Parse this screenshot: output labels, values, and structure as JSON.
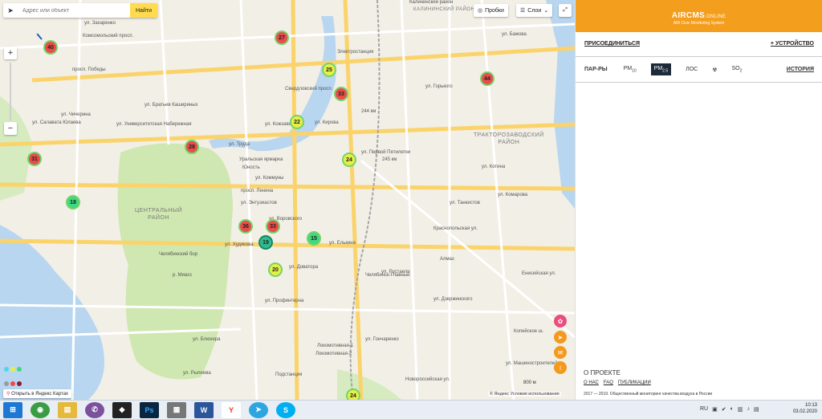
{
  "search": {
    "placeholder": "Адрес или объект",
    "button": "Найти"
  },
  "controls": {
    "traffic": "Пробки",
    "layers": "Слои"
  },
  "zoom": {
    "plus": "+",
    "minus": "−"
  },
  "map_labels": [
    {
      "text": "ул. Захаренко"
    },
    {
      "text": "Комсомольский просп."
    },
    {
      "text": "просп. Победы"
    },
    {
      "text": "ул. Братьев Кашириных"
    },
    {
      "text": "ул. Университетская Набережная"
    },
    {
      "text": "ул. Труда"
    },
    {
      "text": "ул. Коммуны"
    },
    {
      "text": "просп. Ленина"
    },
    {
      "text": "ул. Худякова"
    },
    {
      "text": "ул. Дзержинского"
    },
    {
      "text": "ул. Гончаренко"
    },
    {
      "text": "ул. Профинтерна"
    },
    {
      "text": "Новороссийская ул."
    },
    {
      "text": "ул. Машиностроителей"
    },
    {
      "text": "Краснопольская ул."
    },
    {
      "text": "ул. Первой Пятилетки"
    },
    {
      "text": "Электростанция"
    },
    {
      "text": "Челябинск-Главный"
    },
    {
      "text": "Локомотивная-1"
    },
    {
      "text": "Локомотивная-2"
    },
    {
      "text": "Подстанция"
    },
    {
      "text": "Челябинский бор"
    },
    {
      "text": "Уральская ярмарка"
    },
    {
      "text": "Юность"
    },
    {
      "text": "Алмаз"
    },
    {
      "text": "Калининский район"
    },
    {
      "text": "244 км"
    },
    {
      "text": "245 км"
    },
    {
      "text": "ул. Чичерина"
    },
    {
      "text": "ул. Салавата Юлаева"
    },
    {
      "text": "ул. Энтузиастов"
    },
    {
      "text": "ул. Воровского"
    },
    {
      "text": "ул. Блюхера"
    },
    {
      "text": "ул. Рылеева"
    },
    {
      "text": "ул. Доватора"
    },
    {
      "text": "ул. Елькина"
    },
    {
      "text": "Свердловский просп."
    },
    {
      "text": "ул. Кирова"
    },
    {
      "text": "Енисейская ул."
    },
    {
      "text": "ул. Рустаели"
    },
    {
      "text": "ул. Бажова"
    },
    {
      "text": "ул. Танкистов"
    },
    {
      "text": "ул. Горького"
    },
    {
      "text": "ул. Комарова"
    },
    {
      "text": "ул. Котина"
    },
    {
      "text": "Копейское ш."
    },
    {
      "text": "р. Миасс"
    },
    {
      "text": "ул. Кожзаводская"
    }
  ],
  "districts": [
    {
      "text": "ЦЕНТРАЛЬНЫЙ\nРАЙОН"
    },
    {
      "text": "ТРАКТОРОЗАВОДСКИЙ\nРАЙОН"
    },
    {
      "text": "КАЛИНИНСКИЙ РАЙОН"
    }
  ],
  "markers": [
    {
      "value": "40",
      "level": "red"
    },
    {
      "value": "27",
      "level": "red"
    },
    {
      "value": "25",
      "level": "yellow"
    },
    {
      "value": "44",
      "level": "red"
    },
    {
      "value": "33",
      "level": "red"
    },
    {
      "value": "22",
      "level": "yellow"
    },
    {
      "value": "28",
      "level": "red"
    },
    {
      "value": "24",
      "level": "yellow"
    },
    {
      "value": "31",
      "level": "red"
    },
    {
      "value": "18",
      "level": "green"
    },
    {
      "value": "36",
      "level": "red"
    },
    {
      "value": "33",
      "level": "red"
    },
    {
      "value": "19",
      "level": "teal"
    },
    {
      "value": "15",
      "level": "green"
    },
    {
      "value": "20",
      "level": "yellow"
    },
    {
      "value": "24",
      "level": "yellow"
    }
  ],
  "open_yandex": "Открыть в Яндекс Картах",
  "copyright": "© Яндекс Условия использования",
  "scale": "800 м",
  "brand": {
    "title": "AIRCMS",
    "suffix": ".ONLINE",
    "subtitle": "AIR Civic Monitoring System"
  },
  "actions": {
    "join": "ПРИСОЕДИНИТЬСЯ",
    "device": "+ УСТРОЙСТВО"
  },
  "params": {
    "label": "ПАР-РЫ",
    "pm10": "PM10",
    "pm25": "PM2.5",
    "los": "ЛОС",
    "so2": "SO2",
    "history": "ИСТОРИЯ"
  },
  "about": {
    "title": "О ПРОЕКТЕ",
    "links": [
      "О НАС",
      "FAQ",
      "ПУБЛИКАЦИИ"
    ],
    "footer": "2017 — 2019. Общественный мониторинг качества воздуха в России"
  },
  "taskbar": {
    "apps": [
      "Chrome",
      "Explorer",
      "Viber",
      "Batman",
      "Photoshop",
      "Calc",
      "Word",
      "Yandex",
      "Telegram",
      "Skype"
    ],
    "lang": "RU",
    "time": "10:13",
    "date": "03.02.2020"
  },
  "colors": {
    "accent": "#f49e1d",
    "red": "#ea4b4b",
    "yellow": "#e6ef48",
    "green": "#3fd97e"
  }
}
